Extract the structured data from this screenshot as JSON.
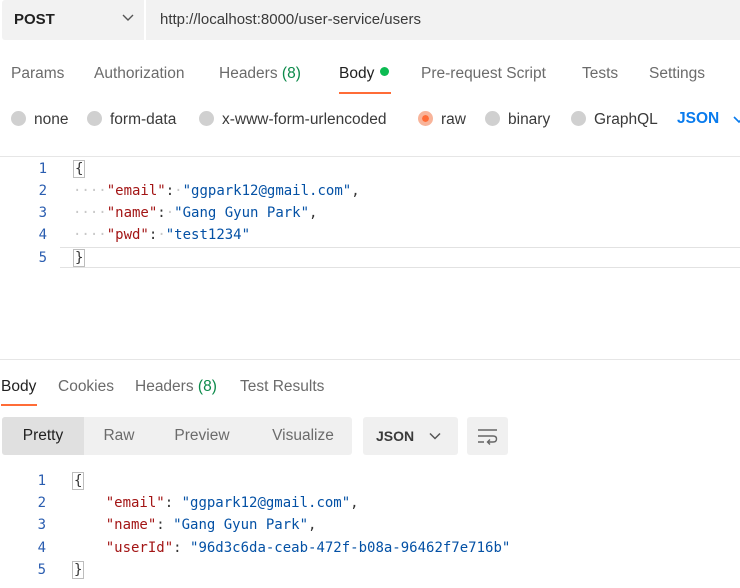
{
  "request": {
    "method": "POST",
    "url": "http://localhost:8000/user-service/users"
  },
  "request_tabs": {
    "params": "Params",
    "authorization": "Authorization",
    "headers": "Headers",
    "headers_count": "(8)",
    "body": "Body",
    "pre_request": "Pre-request Script",
    "tests": "Tests",
    "settings": "Settings"
  },
  "body_types": {
    "none": "none",
    "form_data": "form-data",
    "urlencoded": "x-www-form-urlencoded",
    "raw": "raw",
    "binary": "binary",
    "graphql": "GraphQL",
    "language": "JSON",
    "selected": "raw"
  },
  "request_body": {
    "line_numbers": [
      "1",
      "2",
      "3",
      "4",
      "5"
    ],
    "open_brace": "{",
    "close_brace": "}",
    "fields": [
      {
        "key": "\"email\"",
        "value": "\"ggpark12@gmail.com\"",
        "sep": ","
      },
      {
        "key": "\"name\"",
        "value": "\"Gang Gyun Park\"",
        "sep": ","
      },
      {
        "key": "\"pwd\"",
        "value": "\"test1234\"",
        "sep": ""
      }
    ]
  },
  "response_tabs": {
    "body": "Body",
    "cookies": "Cookies",
    "headers": "Headers",
    "headers_count": "(8)",
    "test_results": "Test Results"
  },
  "response_view": {
    "pretty": "Pretty",
    "raw": "Raw",
    "preview": "Preview",
    "visualize": "Visualize",
    "format": "JSON"
  },
  "response_body": {
    "line_numbers": [
      "1",
      "2",
      "3",
      "4",
      "5"
    ],
    "open_brace": "{",
    "close_brace": "}",
    "fields": [
      {
        "key": "\"email\"",
        "value": "\"ggpark12@gmail.com\"",
        "sep": ","
      },
      {
        "key": "\"name\"",
        "value": "\"Gang Gyun Park\"",
        "sep": ","
      },
      {
        "key": "\"userId\"",
        "value": "\"96d3c6da-ceab-472f-b08a-96462f7e716b\"",
        "sep": ""
      }
    ]
  },
  "colors": {
    "accent": "#ff6c37",
    "status_green": "#0cbb52",
    "link_blue": "#097bed"
  }
}
